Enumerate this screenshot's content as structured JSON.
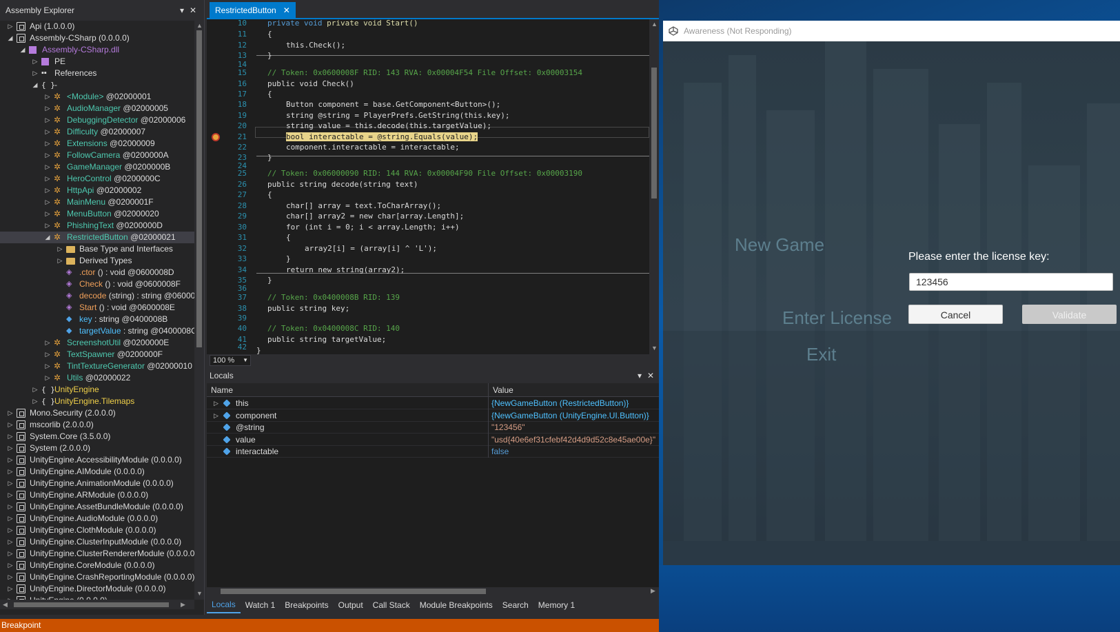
{
  "assembly_explorer": {
    "title": "Assembly Explorer",
    "tree": [
      {
        "label": "Api",
        "token": "(1.0.0.0)",
        "level": 0,
        "expanded": false,
        "icon": "assembly-icon",
        "color": "default"
      },
      {
        "label": "Assembly-CSharp",
        "token": "(0.0.0.0)",
        "level": 0,
        "expanded": true,
        "icon": "assembly-icon",
        "color": "default"
      },
      {
        "label": "Assembly-CSharp.dll",
        "token": "",
        "level": 1,
        "expanded": true,
        "icon": "dll-icon",
        "color": "dll"
      },
      {
        "label": "PE",
        "token": "",
        "level": 2,
        "expanded": false,
        "icon": "pe-icon",
        "color": "default"
      },
      {
        "label": "References",
        "token": "",
        "level": 2,
        "expanded": false,
        "icon": "references-icon",
        "color": "default"
      },
      {
        "label": "-",
        "token": "",
        "level": 2,
        "expanded": true,
        "icon": "namespace-icon",
        "color": "default"
      },
      {
        "label": "<Module>",
        "token": "@02000001",
        "level": 3,
        "expanded": false,
        "icon": "class-icon",
        "color": "type"
      },
      {
        "label": "AudioManager",
        "token": "@02000005",
        "level": 3,
        "expanded": false,
        "icon": "class-icon",
        "color": "type"
      },
      {
        "label": "DebuggingDetector",
        "token": "@02000006",
        "level": 3,
        "expanded": false,
        "icon": "class-icon",
        "color": "type"
      },
      {
        "label": "Difficulty",
        "token": "@02000007",
        "level": 3,
        "expanded": false,
        "icon": "class-icon",
        "color": "type"
      },
      {
        "label": "Extensions",
        "token": "@02000009",
        "level": 3,
        "expanded": false,
        "icon": "class-icon",
        "color": "type"
      },
      {
        "label": "FollowCamera",
        "token": "@0200000A",
        "level": 3,
        "expanded": false,
        "icon": "class-icon",
        "color": "type"
      },
      {
        "label": "GameManager",
        "token": "@0200000B",
        "level": 3,
        "expanded": false,
        "icon": "class-icon",
        "color": "type"
      },
      {
        "label": "HeroControl",
        "token": "@0200000C",
        "level": 3,
        "expanded": false,
        "icon": "class-icon",
        "color": "type"
      },
      {
        "label": "HttpApi",
        "token": "@02000002",
        "level": 3,
        "expanded": false,
        "icon": "class-icon",
        "color": "type"
      },
      {
        "label": "MainMenu",
        "token": "@0200001F",
        "level": 3,
        "expanded": false,
        "icon": "class-icon",
        "color": "type"
      },
      {
        "label": "MenuButton",
        "token": "@02000020",
        "level": 3,
        "expanded": false,
        "icon": "class-icon",
        "color": "type"
      },
      {
        "label": "PhishingText",
        "token": "@0200000D",
        "level": 3,
        "expanded": false,
        "icon": "class-icon",
        "color": "type"
      },
      {
        "label": "RestrictedButton",
        "token": "@02000021",
        "level": 3,
        "expanded": true,
        "icon": "class-icon",
        "color": "type",
        "selected": true
      },
      {
        "label": "Base Type and Interfaces",
        "token": "",
        "level": 4,
        "expanded": false,
        "icon": "folder-icon",
        "color": "default"
      },
      {
        "label": "Derived Types",
        "token": "",
        "level": 4,
        "expanded": false,
        "icon": "folder-icon",
        "color": "default"
      },
      {
        "label": ".ctor",
        "token": "() : void @0600008D",
        "level": 4,
        "icon": "method-icon",
        "color": "method",
        "leaf": true
      },
      {
        "label": "Check",
        "token": "() : void @0600008F",
        "level": 4,
        "icon": "method-icon",
        "color": "method",
        "leaf": true
      },
      {
        "label": "decode",
        "token": "(string) : string @06000",
        "level": 4,
        "icon": "method-icon",
        "color": "method",
        "leaf": true
      },
      {
        "label": "Start",
        "token": "() : void @0600008E",
        "level": 4,
        "icon": "private-method-icon",
        "color": "method",
        "leaf": true
      },
      {
        "label": "key",
        "token": ": string @0400008B",
        "level": 4,
        "icon": "field-icon",
        "color": "field",
        "leaf": true
      },
      {
        "label": "targetValue",
        "token": ": string @0400008C",
        "level": 4,
        "icon": "field-icon",
        "color": "field",
        "leaf": true
      },
      {
        "label": "ScreenshotUtil",
        "token": "@0200000E",
        "level": 3,
        "expanded": false,
        "icon": "class-icon",
        "color": "type"
      },
      {
        "label": "TextSpawner",
        "token": "@0200000F",
        "level": 3,
        "expanded": false,
        "icon": "class-icon",
        "color": "type"
      },
      {
        "label": "TintTextureGenerator",
        "token": "@02000010",
        "level": 3,
        "expanded": false,
        "icon": "class-icon",
        "color": "type"
      },
      {
        "label": "Utils",
        "token": "@02000022",
        "level": 3,
        "expanded": false,
        "icon": "class-icon",
        "color": "type"
      },
      {
        "label": "UnityEngine",
        "token": "",
        "level": 2,
        "expanded": false,
        "icon": "namespace-icon",
        "color": "ns2"
      },
      {
        "label": "UnityEngine.Tilemaps",
        "token": "",
        "level": 2,
        "expanded": false,
        "icon": "namespace-icon",
        "color": "ns2"
      },
      {
        "label": "Mono.Security",
        "token": "(2.0.0.0)",
        "level": 0,
        "expanded": false,
        "icon": "assembly-icon",
        "color": "default"
      },
      {
        "label": "mscorlib",
        "token": "(2.0.0.0)",
        "level": 0,
        "expanded": false,
        "icon": "assembly-icon",
        "color": "default"
      },
      {
        "label": "System.Core",
        "token": "(3.5.0.0)",
        "level": 0,
        "expanded": false,
        "icon": "assembly-icon",
        "color": "default"
      },
      {
        "label": "System",
        "token": "(2.0.0.0)",
        "level": 0,
        "expanded": false,
        "icon": "assembly-icon",
        "color": "default"
      },
      {
        "label": "UnityEngine.AccessibilityModule",
        "token": "(0.0.0.0)",
        "level": 0,
        "expanded": false,
        "icon": "assembly-icon",
        "color": "default"
      },
      {
        "label": "UnityEngine.AIModule",
        "token": "(0.0.0.0)",
        "level": 0,
        "expanded": false,
        "icon": "assembly-icon",
        "color": "default"
      },
      {
        "label": "UnityEngine.AnimationModule",
        "token": "(0.0.0.0)",
        "level": 0,
        "expanded": false,
        "icon": "assembly-icon",
        "color": "default"
      },
      {
        "label": "UnityEngine.ARModule",
        "token": "(0.0.0.0)",
        "level": 0,
        "expanded": false,
        "icon": "assembly-icon",
        "color": "default"
      },
      {
        "label": "UnityEngine.AssetBundleModule",
        "token": "(0.0.0.0)",
        "level": 0,
        "expanded": false,
        "icon": "assembly-icon",
        "color": "default"
      },
      {
        "label": "UnityEngine.AudioModule",
        "token": "(0.0.0.0)",
        "level": 0,
        "expanded": false,
        "icon": "assembly-icon",
        "color": "default"
      },
      {
        "label": "UnityEngine.ClothModule",
        "token": "(0.0.0.0)",
        "level": 0,
        "expanded": false,
        "icon": "assembly-icon",
        "color": "default"
      },
      {
        "label": "UnityEngine.ClusterInputModule",
        "token": "(0.0.0.0)",
        "level": 0,
        "expanded": false,
        "icon": "assembly-icon",
        "color": "default"
      },
      {
        "label": "UnityEngine.ClusterRendererModule",
        "token": "(0.0.0.0)",
        "level": 0,
        "expanded": false,
        "icon": "assembly-icon",
        "color": "default"
      },
      {
        "label": "UnityEngine.CoreModule",
        "token": "(0.0.0.0)",
        "level": 0,
        "expanded": false,
        "icon": "assembly-icon",
        "color": "default"
      },
      {
        "label": "UnityEngine.CrashReportingModule",
        "token": "(0.0.0.0)",
        "level": 0,
        "expanded": false,
        "icon": "assembly-icon",
        "color": "default"
      },
      {
        "label": "UnityEngine.DirectorModule",
        "token": "(0.0.0.0)",
        "level": 0,
        "expanded": false,
        "icon": "assembly-icon",
        "color": "default"
      },
      {
        "label": "UnityEngine",
        "token": "(0.0.0.0)",
        "level": 0,
        "expanded": false,
        "icon": "assembly-icon",
        "color": "default"
      }
    ]
  },
  "editor": {
    "tab_label": "RestrictedButton",
    "zoom": "100 %",
    "line_numbers": [
      "10",
      "11",
      "12",
      "13",
      "14",
      "15",
      "16",
      "17",
      "18",
      "19",
      "20",
      "21",
      "22",
      "23",
      "24",
      "25",
      "26",
      "27",
      "28",
      "29",
      "30",
      "31",
      "32",
      "33",
      "34",
      "35",
      "36",
      "37",
      "38",
      "39",
      "40",
      "41",
      "42"
    ],
    "breakpoint_line": "21",
    "code": {
      "l10": "private void Start()",
      "l11": "{",
      "l12": "this.Check();",
      "l13": "}",
      "l15": "// Token: 0x0600008F RID: 143 RVA: 0x00004F54 File Offset: 0x00003154",
      "l16": "public void Check()",
      "l17": "{",
      "l18": "Button component = base.GetComponent<Button>();",
      "l19": "string @string = PlayerPrefs.GetString(this.key);",
      "l20": "string value = this.decode(this.targetValue);",
      "l21": "bool interactable = @string.Equals(value);",
      "l22": "component.interactable = interactable;",
      "l23": "}",
      "l25": "// Token: 0x06000090 RID: 144 RVA: 0x00004F90 File Offset: 0x00003190",
      "l26": "public string decode(string text)",
      "l27": "{",
      "l28": "char[] array = text.ToCharArray();",
      "l29": "char[] array2 = new char[array.Length];",
      "l30": "for (int i = 0; i < array.Length; i++)",
      "l31": "{",
      "l32": "array2[i] = (array[i] ^ 'L');",
      "l33": "}",
      "l34": "return new string(array2);",
      "l35": "}",
      "l37": "// Token: 0x0400008B RID: 139",
      "l38": "public string key;",
      "l40": "// Token: 0x0400008C RID: 140",
      "l41": "public string targetValue;",
      "l42": "}"
    }
  },
  "locals": {
    "title": "Locals",
    "col_name": "Name",
    "col_value": "Value",
    "rows": [
      {
        "name": "this",
        "value": "{NewGameButton (RestrictedButton)}",
        "kind": "obj",
        "expandable": true
      },
      {
        "name": "component",
        "value": "{NewGameButton (UnityEngine.UI.Button)}",
        "kind": "obj",
        "expandable": true
      },
      {
        "name": "@string",
        "value": "\"123456\"",
        "kind": "str",
        "expandable": false
      },
      {
        "name": "value",
        "value": "\"usd{40e6ef31cfebf42d4d9d52c8e45ae00e}\"",
        "kind": "str",
        "expandable": false
      },
      {
        "name": "interactable",
        "value": "false",
        "kind": "bool",
        "expandable": false
      }
    ]
  },
  "bottom_tabs": [
    "Locals",
    "Watch 1",
    "Breakpoints",
    "Output",
    "Call Stack",
    "Module Breakpoints",
    "Search",
    "Memory 1"
  ],
  "status": "Breakpoint",
  "game": {
    "window_title": "Awareness (Not Responding)",
    "menu": {
      "new_game": "New Game",
      "enter_license": "Enter License",
      "exit": "Exit"
    },
    "license_prompt": "Please enter the license key:",
    "license_value": "123456",
    "cancel": "Cancel",
    "validate": "Validate"
  },
  "colors": {
    "accent": "#007acc",
    "status_bar": "#ca5100",
    "type_name": "#4ec9b0",
    "breakpoint_highlight": "#e8d48a"
  }
}
